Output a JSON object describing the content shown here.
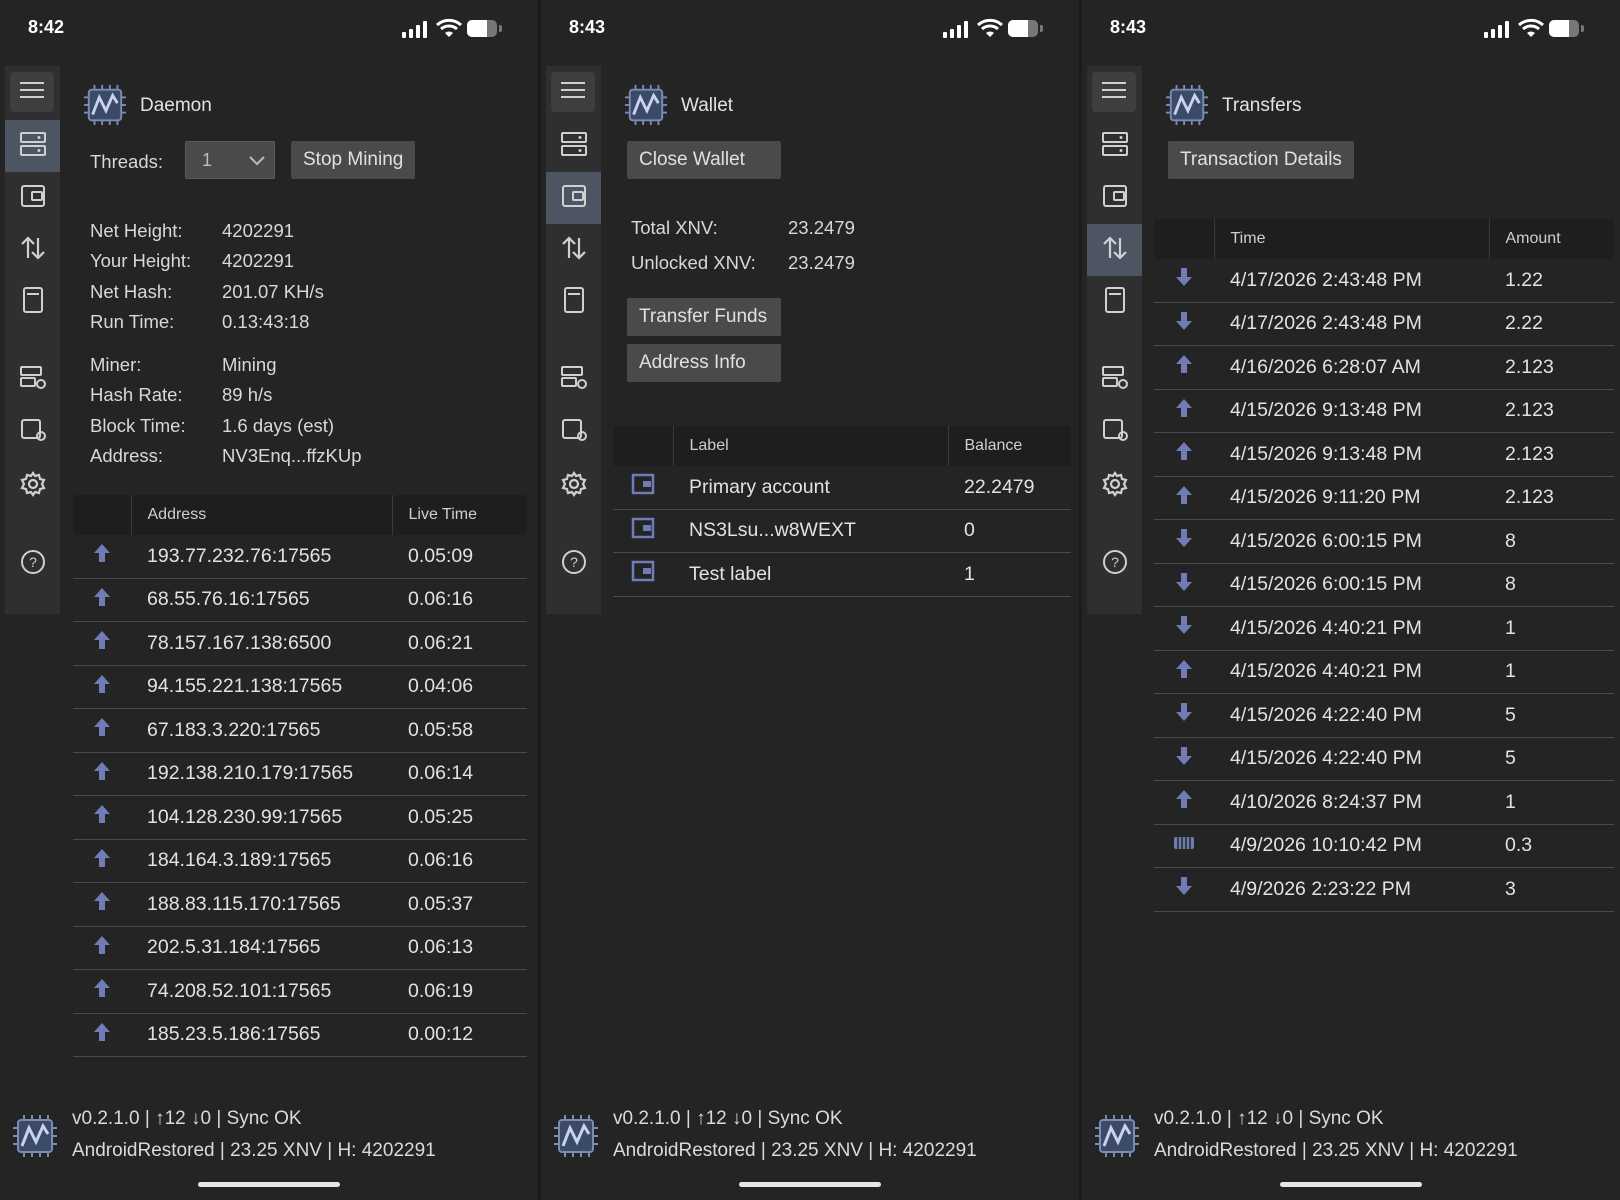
{
  "colors": {
    "accent": "#4d5563",
    "arrow": "#6f7cb5",
    "background": "#242425"
  },
  "daemon": {
    "status_time": "8:42",
    "title": "Daemon",
    "threads_label": "Threads:",
    "threads_value": "1",
    "stop_mining": "Stop Mining",
    "stats": [
      {
        "label": "Net Height:",
        "value": "4202291"
      },
      {
        "label": "Your Height:",
        "value": "4202291"
      },
      {
        "label": "Net Hash:",
        "value": "201.07 KH/s"
      },
      {
        "label": "Run Time:",
        "value": "0.13:43:18"
      },
      {
        "label": "Miner:",
        "value": "Mining"
      },
      {
        "label": "Hash Rate:",
        "value": "89 h/s"
      },
      {
        "label": "Block Time:",
        "value": "1.6 days (est)"
      },
      {
        "label": "Address:",
        "value": "NV3Enq...ffzKUp"
      }
    ],
    "peers_header": {
      "address": "Address",
      "live_time": "Live Time"
    },
    "peers": [
      {
        "icon": "arrow-up-icon",
        "address": "193.77.232.76:17565",
        "time": "0.05:09"
      },
      {
        "icon": "arrow-up-icon",
        "address": "68.55.76.16:17565",
        "time": "0.06:16"
      },
      {
        "icon": "arrow-up-icon",
        "address": "78.157.167.138:6500",
        "time": "0.06:21"
      },
      {
        "icon": "arrow-up-icon",
        "address": "94.155.221.138:17565",
        "time": "0.04:06"
      },
      {
        "icon": "arrow-up-icon",
        "address": "67.183.3.220:17565",
        "time": "0.05:58"
      },
      {
        "icon": "arrow-up-icon",
        "address": "192.138.210.179:17565",
        "time": "0.06:14"
      },
      {
        "icon": "arrow-up-icon",
        "address": "104.128.230.99:17565",
        "time": "0.05:25"
      },
      {
        "icon": "arrow-up-icon",
        "address": "184.164.3.189:17565",
        "time": "0.06:16"
      },
      {
        "icon": "arrow-up-icon",
        "address": "188.83.115.170:17565",
        "time": "0.05:37"
      },
      {
        "icon": "arrow-up-icon",
        "address": "202.5.31.184:17565",
        "time": "0.06:13"
      },
      {
        "icon": "arrow-up-icon",
        "address": "74.208.52.101:17565",
        "time": "0.06:19"
      },
      {
        "icon": "arrow-up-icon",
        "address": "185.23.5.186:17565",
        "time": "0.00:12"
      }
    ]
  },
  "wallet": {
    "status_time": "8:43",
    "title": "Wallet",
    "close_wallet": "Close Wallet",
    "total_label": "Total XNV:",
    "total_value": "23.2479",
    "unlocked_label": "Unlocked XNV:",
    "unlocked_value": "23.2479",
    "transfer_funds": "Transfer Funds",
    "address_info": "Address Info",
    "accounts_header": {
      "label": "Label",
      "balance": "Balance"
    },
    "accounts": [
      {
        "icon": "wallet-icon",
        "label": "Primary account",
        "balance": "22.2479"
      },
      {
        "icon": "wallet-icon",
        "label": "NS3Lsu...w8WEXT",
        "balance": "0"
      },
      {
        "icon": "wallet-icon",
        "label": "Test label",
        "balance": "1"
      }
    ]
  },
  "transfers": {
    "status_time": "8:43",
    "title": "Transfers",
    "transaction_details": "Transaction Details",
    "header": {
      "time": "Time",
      "amount": "Amount"
    },
    "rows": [
      {
        "icon": "arrow-down-icon",
        "time": "4/17/2026 2:43:48 PM",
        "amount": "1.22"
      },
      {
        "icon": "arrow-down-icon",
        "time": "4/17/2026 2:43:48 PM",
        "amount": "2.22"
      },
      {
        "icon": "arrow-up-icon",
        "time": "4/16/2026 6:28:07 AM",
        "amount": "2.123"
      },
      {
        "icon": "arrow-up-icon",
        "time": "4/15/2026 9:13:48 PM",
        "amount": "2.123"
      },
      {
        "icon": "arrow-up-icon",
        "time": "4/15/2026 9:13:48 PM",
        "amount": "2.123"
      },
      {
        "icon": "arrow-up-icon",
        "time": "4/15/2026 9:11:20 PM",
        "amount": "2.123"
      },
      {
        "icon": "arrow-down-icon",
        "time": "4/15/2026 6:00:15 PM",
        "amount": "8"
      },
      {
        "icon": "arrow-down-icon",
        "time": "4/15/2026 6:00:15 PM",
        "amount": "8"
      },
      {
        "icon": "arrow-down-icon",
        "time": "4/15/2026 4:40:21 PM",
        "amount": "1"
      },
      {
        "icon": "arrow-up-icon",
        "time": "4/15/2026 4:40:21 PM",
        "amount": "1"
      },
      {
        "icon": "arrow-down-icon",
        "time": "4/15/2026 4:22:40 PM",
        "amount": "5"
      },
      {
        "icon": "arrow-down-icon",
        "time": "4/15/2026 4:22:40 PM",
        "amount": "5"
      },
      {
        "icon": "arrow-up-icon",
        "time": "4/10/2026 8:24:37 PM",
        "amount": "1"
      },
      {
        "icon": "mining-icon",
        "time": "4/9/2026 10:10:42 PM",
        "amount": "0.3"
      },
      {
        "icon": "arrow-down-icon",
        "time": "4/9/2026 2:23:22 PM",
        "amount": "3"
      }
    ]
  },
  "footer": {
    "line1": "v0.2.1.0 | ↑12  ↓0 | Sync OK",
    "line2": "AndroidRestored  | 23.25 XNV | H: 4202291"
  },
  "sidebar_items": [
    "menu-icon",
    "daemon-icon",
    "wallet-icon",
    "transfers-icon",
    "address-book-icon",
    "daemon-settings-icon",
    "wallet-settings-icon",
    "gear-icon",
    "help-icon"
  ]
}
